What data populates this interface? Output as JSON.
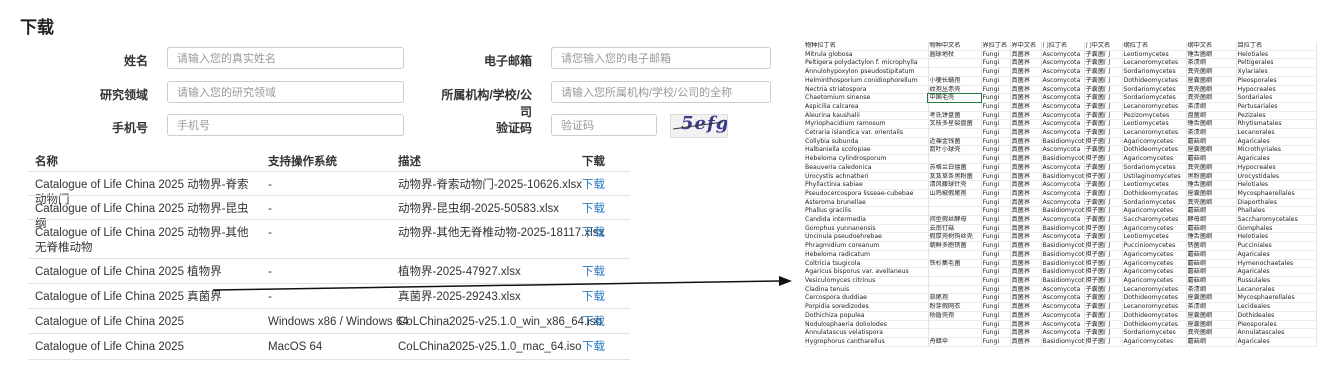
{
  "page_title": "下载",
  "form": {
    "name_label": "姓名",
    "name_placeholder": "请输入您的真实姓名",
    "email_label": "电子邮箱",
    "email_placeholder": "请您输入您的电子邮箱",
    "field_label": "研究领域",
    "field_placeholder": "请输入您的研究领域",
    "org_label": "所属机构/学校/公司",
    "org_placeholder": "请输入您所属机构/学校/公司的全称",
    "phone_label": "手机号",
    "phone_placeholder": "手机号",
    "captcha_label": "验证码",
    "captcha_placeholder": "验证码",
    "captcha_text": "5efg"
  },
  "table": {
    "headers": {
      "name": "名称",
      "os": "支持操作系统",
      "desc": "描述",
      "download": "下载"
    },
    "rows": [
      {
        "name": "Catalogue of Life China 2025 动物界-脊索动物门",
        "os": "-",
        "desc": "动物界-脊索动物门-2025-10626.xlsx",
        "download": "下载"
      },
      {
        "name": "Catalogue of Life China 2025 动物界-昆虫纲",
        "os": "-",
        "desc": "动物界-昆虫纲-2025-50583.xlsx",
        "download": "下载"
      },
      {
        "name": "Catalogue of Life China 2025 动物界-其他无脊椎动物",
        "os": "-",
        "desc": "动物界-其他无脊椎动物-2025-18117.xlsx",
        "download": "下载"
      },
      {
        "name": "Catalogue of Life China 2025 植物界",
        "os": "-",
        "desc": "植物界-2025-47927.xlsx",
        "download": "下载"
      },
      {
        "name": "Catalogue of Life China 2025 真菌界",
        "os": "-",
        "desc": "真菌界-2025-29243.xlsx",
        "download": "下载"
      },
      {
        "name": "Catalogue of Life China 2025",
        "os": "Windows x86 / Windows 64",
        "desc": "CoLChina2025-v25.1.0_win_x86_64.iso",
        "download": "下载"
      },
      {
        "name": "Catalogue of Life China 2025",
        "os": "MacOS 64",
        "desc": "CoLChina2025-v25.1.0_mac_64.iso",
        "download": "下载"
      }
    ]
  },
  "spreadsheet": {
    "headers": [
      "物种拉丁名",
      "物种中文名",
      "界拉丁名",
      "界中文名",
      "门拉丁名",
      "门中文名",
      "纲拉丁名",
      "纲中文名",
      "目拉丁名"
    ],
    "rows": [
      [
        "Mitrula globosa",
        "圆球地杖",
        "Fungi",
        "真菌界",
        "Ascomycota",
        "子囊菌门",
        "Leotiomycetes",
        "锤舌菌纲",
        "Helotiales"
      ],
      [
        "Peltigera polydactylon f. microphylla",
        "",
        "Fungi",
        "真菌界",
        "Ascomycota",
        "子囊菌门",
        "Lecanoromycetes",
        "茶渍纲",
        "Peltigerales"
      ],
      [
        "Annulohypoxylon pseudostipitatum",
        "",
        "Fungi",
        "真菌界",
        "Ascomycota",
        "子囊菌门",
        "Sordariomycetes",
        "粪壳菌纲",
        "Xylariales"
      ],
      [
        "Helminthosporium conidiophorellum",
        "小梗长蠕孢",
        "Fungi",
        "真菌界",
        "Ascomycota",
        "子囊菌门",
        "Dothideomycetes",
        "座囊菌纲",
        "Pleosporales"
      ],
      [
        "Nectria striatospora",
        "纹孢丛赤壳",
        "Fungi",
        "真菌界",
        "Ascomycota",
        "子囊菌门",
        "Sordariomycetes",
        "粪壳菌纲",
        "Hypocreales"
      ],
      [
        "Chaetomium sinense",
        "中国毛壳",
        "Fungi",
        "真菌界",
        "Ascomycota",
        "子囊菌门",
        "Sordariomycetes",
        "粪壳菌纲",
        "Sordariales"
      ],
      [
        "Aspicilia calcarea",
        "",
        "Fungi",
        "真菌界",
        "Ascomycota",
        "子囊菌门",
        "Lecanoromycetes",
        "茶渍纲",
        "Pertusariales"
      ],
      [
        "Aleurina kaushalii",
        "考氏饼盘菌",
        "Fungi",
        "真菌界",
        "Ascomycota",
        "子囊菌门",
        "Pezizomycetes",
        "盘菌纲",
        "Pezizales"
      ],
      [
        "Myriophacidium ramosum",
        "叉枝多星裂盘菌",
        "Fungi",
        "真菌界",
        "Ascomycota",
        "子囊菌门",
        "Leotiomycetes",
        "锤舌菌纲",
        "Rhytismatales"
      ],
      [
        "Cetraria islandica var. orientalis",
        "",
        "Fungi",
        "真菌界",
        "Ascomycota",
        "子囊菌门",
        "Lecanoromycetes",
        "茶渍纲",
        "Lecanorales"
      ],
      [
        "Collybia subunda",
        "近裸金钱菌",
        "Fungi",
        "真菌界",
        "Basidiomycota",
        "担子菌门",
        "Agaricomycetes",
        "蘑菇纲",
        "Agaricales"
      ],
      [
        "Halbaniella scolopiae",
        "箭叶小球壳",
        "Fungi",
        "真菌界",
        "Ascomycota",
        "子囊菌门",
        "Dothideomycetes",
        "座囊菌纲",
        "Microthyriales"
      ],
      [
        "Hebeloma cylindrosporum",
        "",
        "Fungi",
        "真菌界",
        "Basidiomycota",
        "担子菌门",
        "Agaricomycetes",
        "蘑菇纲",
        "Agaricales"
      ],
      [
        "Beauveria caledonica",
        "苏格兰白僵菌",
        "Fungi",
        "真菌界",
        "Ascomycota",
        "子囊菌门",
        "Sordariomycetes",
        "粪壳菌纲",
        "Hypocreales"
      ],
      [
        "Urocystis achnatheri",
        "芨芨草条黑粉菌",
        "Fungi",
        "真菌界",
        "Basidiomycota",
        "担子菌门",
        "Ustilaginomycetes",
        "黑粉菌纲",
        "Urocystidales"
      ],
      [
        "Phyllactinia sabiae",
        "清风藤球针壳",
        "Fungi",
        "真菌界",
        "Ascomycota",
        "子囊菌门",
        "Leotiomycetes",
        "锤舌菌纲",
        "Helotiales"
      ],
      [
        "Pseudocercospora lisseae-cubebae",
        "山鸡椒假尾孢",
        "Fungi",
        "真菌界",
        "Ascomycota",
        "子囊菌门",
        "Dothideomycetes",
        "座囊菌纲",
        "Mycosphaerellales"
      ],
      [
        "Asteroma brunellae",
        "",
        "Fungi",
        "真菌界",
        "Ascomycota",
        "子囊菌门",
        "Sordariomycetes",
        "粪壳菌纲",
        "Diaporthales"
      ],
      [
        "Phallus gracilis",
        "",
        "Fungi",
        "真菌界",
        "Basidiomycota",
        "担子菌门",
        "Agaricomycetes",
        "蘑菇纲",
        "Phallales"
      ],
      [
        "Candida intermedia",
        "间型假丝酵母",
        "Fungi",
        "真菌界",
        "Ascomycota",
        "子囊菌门",
        "Saccharomycetes",
        "酵母纲",
        "Saccharomycetales"
      ],
      [
        "Gomphus yunnanensis",
        "云南钉菇",
        "Fungi",
        "真菌界",
        "Basidiomycota",
        "担子菌门",
        "Agaricomycetes",
        "蘑菇纲",
        "Gomphales"
      ],
      [
        "Uncinula pseudoehrebae",
        "假厚壳树钩丝壳",
        "Fungi",
        "真菌界",
        "Ascomycota",
        "子囊菌门",
        "Leotiomycetes",
        "锤舌菌纲",
        "Helotiales"
      ],
      [
        "Phragmidium coreanum",
        "朝鲜多胞锈菌",
        "Fungi",
        "真菌界",
        "Basidiomycota",
        "担子菌门",
        "Pucciniomycetes",
        "锈菌纲",
        "Pucciniales"
      ],
      [
        "Hebeloma radicatum",
        "",
        "Fungi",
        "真菌界",
        "Basidiomycota",
        "担子菌门",
        "Agaricomycetes",
        "蘑菇纲",
        "Agaricales"
      ],
      [
        "Coltricia tsugicola",
        "铁杉集毛菌",
        "Fungi",
        "真菌界",
        "Basidiomycota",
        "担子菌门",
        "Agaricomycetes",
        "蘑菇纲",
        "Hymenochaetales"
      ],
      [
        "Agaricus bisporus var. avellaneus",
        "",
        "Fungi",
        "真菌界",
        "Basidiomycota",
        "担子菌门",
        "Agaricomycetes",
        "蘑菇纲",
        "Agaricales"
      ],
      [
        "Vesiculomyces citrinus",
        "",
        "Fungi",
        "真菌界",
        "Basidiomycota",
        "担子菌门",
        "Agaricomycetes",
        "蘑菇纲",
        "Russulales"
      ],
      [
        "Cladina tenuis",
        "",
        "Fungi",
        "真菌界",
        "Ascomycota",
        "子囊菌门",
        "Lecanoromycetes",
        "茶渍纲",
        "Lecanorales"
      ],
      [
        "Cercospora duddiae",
        "蒜尾孢",
        "Fungi",
        "真菌界",
        "Ascomycota",
        "子囊菌门",
        "Dothideomycetes",
        "座囊菌纲",
        "Mycosphaerellales"
      ],
      [
        "Porpidia soredizodes",
        "粉芽假网衣",
        "Fungi",
        "真菌界",
        "Ascomycota",
        "子囊菌门",
        "Lecanoromycetes",
        "茶渍纲",
        "Lecideales"
      ],
      [
        "Dothichiza populea",
        "杨盾壳孢",
        "Fungi",
        "真菌界",
        "Ascomycota",
        "子囊菌门",
        "Dothideomycetes",
        "座囊菌纲",
        "Dothideales"
      ],
      [
        "Nodulosphaeria doliolodes",
        "",
        "Fungi",
        "真菌界",
        "Ascomycota",
        "子囊菌门",
        "Dothideomycetes",
        "座囊菌纲",
        "Pleosporales"
      ],
      [
        "Annulatascus velatispora",
        "",
        "Fungi",
        "真菌界",
        "Ascomycota",
        "子囊菌门",
        "Sordariomycetes",
        "粪壳菌纲",
        "Annulatascales"
      ],
      [
        "Hygrophorus cantharellus",
        "舟蜡伞",
        "Fungi",
        "真菌界",
        "Basidiomycota",
        "担子菌门",
        "Agaricomycetes",
        "蘑菇纲",
        "Agaricales"
      ]
    ]
  }
}
